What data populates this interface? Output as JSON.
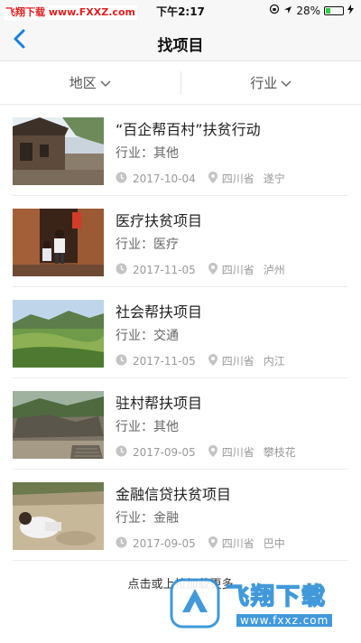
{
  "status": {
    "watermark": "飞翔下载 www.FXXZ.com",
    "time": "下午2:17",
    "battery": "28%",
    "battery_level": 0.28
  },
  "nav": {
    "title": "找项目",
    "back_icon": "chevron-left-icon"
  },
  "filters": [
    {
      "label": "地区",
      "icon": "chevron-down-icon"
    },
    {
      "label": "行业",
      "icon": "chevron-down-icon"
    }
  ],
  "projects": [
    {
      "title": "“百企帮百村”扶贫行动",
      "industry": "行业：其他",
      "date": "2017-10-04",
      "province": "四川省",
      "city": "遂宁"
    },
    {
      "title": "医疗扶贫项目",
      "industry": "行业：医疗",
      "date": "2017-11-05",
      "province": "四川省",
      "city": "泸州"
    },
    {
      "title": "社会帮扶项目",
      "industry": "行业：交通",
      "date": "2017-11-05",
      "province": "四川省",
      "city": "内江"
    },
    {
      "title": "驻村帮扶项目",
      "industry": "行业：其他",
      "date": "2017-09-05",
      "province": "四川省",
      "city": "攀枝花"
    },
    {
      "title": "金融信贷扶贫项目",
      "industry": "行业：金融",
      "date": "2017-09-05",
      "province": "四川省",
      "city": "巴中"
    }
  ],
  "load_more": "点击或上拉加载更多",
  "watermark_bottom": {
    "title": "飞翔下载",
    "url": "www.fxxz.com"
  },
  "colors": {
    "accent": "#1a7fe0",
    "icon_gray": "#c4c4c4"
  }
}
